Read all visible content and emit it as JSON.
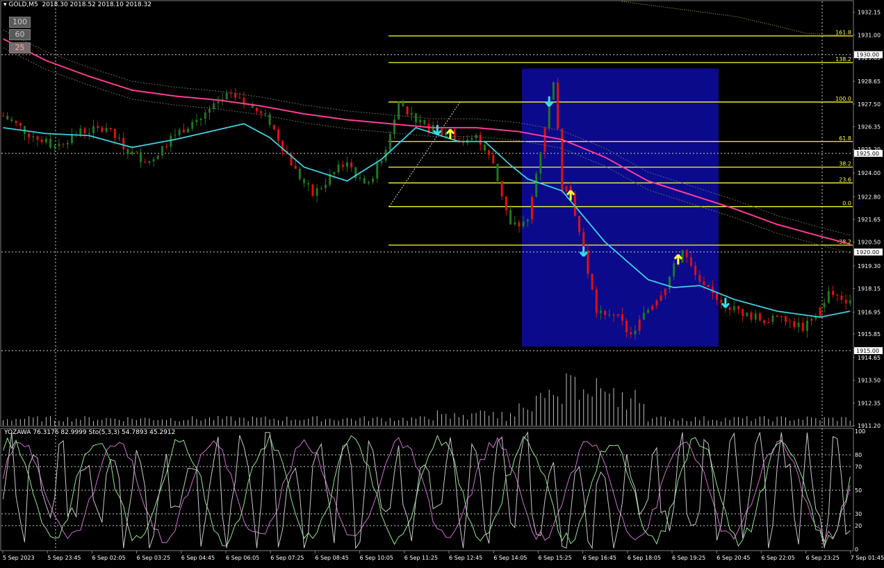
{
  "header": {
    "symbol": "GOLD,M5",
    "ohlc": "2018.30 2018.52 2018.10 2018.32"
  },
  "zoom_buttons": [
    "100",
    "60",
    "25"
  ],
  "colors": {
    "background": "#000000",
    "bull": "#1f7a1f",
    "bear": "#e01010",
    "ma_fast": "#3fd0e0",
    "ma_slow": "#ff3c96",
    "fib": "#ffff33",
    "box": "#0a0a8a",
    "grid": "#cfcfcf",
    "arrow_up": "#ffff33",
    "arrow_down": "#33e0f0"
  },
  "price_axis": {
    "ticks": [
      "1932.15",
      "1931.00",
      "1929.85",
      "1928.65",
      "1927.50",
      "1926.35",
      "1925.20",
      "1924.00",
      "1922.80",
      "1921.65",
      "1920.50",
      "1919.30",
      "1918.15",
      "1916.95",
      "1915.85",
      "1914.65",
      "1913.50",
      "1912.35",
      "1911.20"
    ],
    "highlighted": [
      "1930.00",
      "1925.00",
      "1920.00",
      "1915.00"
    ]
  },
  "fibonacci": {
    "levels": [
      {
        "label": "161.8",
        "price": 1930.95
      },
      {
        "label": "138.2",
        "price": 1929.6
      },
      {
        "label": "100.0",
        "price": 1927.6
      },
      {
        "label": "61.8",
        "price": 1925.6
      },
      {
        "label": "38.2",
        "price": 1924.3
      },
      {
        "label": "23.6",
        "price": 1923.5
      },
      {
        "label": "0.0",
        "price": 1922.3
      },
      {
        "label": "-38.2",
        "price": 1920.35
      }
    ]
  },
  "time_axis": [
    "5 Sep 2023",
    "5 Sep 23:45",
    "6 Sep 02:05",
    "6 Sep 03:25",
    "6 Sep 04:45",
    "6 Sep 06:05",
    "6 Sep 07:25",
    "6 Sep 08:45",
    "6 Sep 10:05",
    "6 Sep 11:25",
    "6 Sep 12:45",
    "6 Sep 14:05",
    "6 Sep 15:25",
    "6 Sep 16:45",
    "6 Sep 18:05",
    "6 Sep 19:25",
    "6 Sep 20:45",
    "6 Sep 22:05",
    "6 Sep 23:25",
    "7 Sep 01:45"
  ],
  "indicator": {
    "label": "YOZAWA 76.3176 82.9999  Sto(5,3,3) 54.7893 45.2912",
    "levels": [
      "100",
      "80",
      "70",
      "50",
      "30",
      "20",
      "0"
    ]
  },
  "chart_data": {
    "type": "candlestick",
    "symbol": "GOLD",
    "timeframe": "M5",
    "y_range": [
      1911.2,
      1932.7
    ],
    "close_path": [
      [
        0,
        1926.9
      ],
      [
        6,
        1926.0
      ],
      [
        12,
        1925.4
      ],
      [
        18,
        1926.1
      ],
      [
        24,
        1926.2
      ],
      [
        30,
        1925.0
      ],
      [
        34,
        1924.6
      ],
      [
        40,
        1926.0
      ],
      [
        46,
        1926.8
      ],
      [
        52,
        1927.9
      ],
      [
        58,
        1927.3
      ],
      [
        62,
        1926.6
      ],
      [
        68,
        1924.1
      ],
      [
        72,
        1922.9
      ],
      [
        76,
        1923.8
      ],
      [
        80,
        1924.6
      ],
      [
        84,
        1923.3
      ],
      [
        88,
        1924.6
      ],
      [
        92,
        1927.6
      ],
      [
        98,
        1926.3
      ],
      [
        104,
        1926.0
      ],
      [
        108,
        1925.5
      ],
      [
        110,
        1925.8
      ],
      [
        114,
        1924.5
      ],
      [
        116,
        1922.9
      ],
      [
        118,
        1921.3
      ],
      [
        122,
        1921.5
      ],
      [
        124,
        1924.0
      ],
      [
        128,
        1928.8
      ],
      [
        130,
        1923.3
      ],
      [
        132,
        1922.9
      ],
      [
        134,
        1921.0
      ],
      [
        138,
        1917.0
      ],
      [
        142,
        1916.9
      ],
      [
        146,
        1915.8
      ],
      [
        150,
        1917.1
      ],
      [
        154,
        1918.3
      ],
      [
        158,
        1920.1
      ],
      [
        162,
        1918.3
      ],
      [
        166,
        1917.7
      ],
      [
        170,
        1917.1
      ],
      [
        176,
        1916.6
      ],
      [
        182,
        1916.5
      ],
      [
        186,
        1916.2
      ],
      [
        188,
        1916.4
      ],
      [
        192,
        1917.9
      ],
      [
        196,
        1917.6
      ]
    ],
    "ma_fast": [
      [
        0,
        1926.3
      ],
      [
        10,
        1926.0
      ],
      [
        20,
        1925.9
      ],
      [
        30,
        1925.3
      ],
      [
        40,
        1925.7
      ],
      [
        50,
        1926.2
      ],
      [
        56,
        1926.5
      ],
      [
        62,
        1925.8
      ],
      [
        70,
        1924.3
      ],
      [
        80,
        1923.6
      ],
      [
        88,
        1924.7
      ],
      [
        96,
        1926.3
      ],
      [
        106,
        1925.6
      ],
      [
        112,
        1925.6
      ],
      [
        118,
        1924.4
      ],
      [
        122,
        1923.7
      ],
      [
        130,
        1923.1
      ],
      [
        140,
        1920.5
      ],
      [
        150,
        1918.6
      ],
      [
        156,
        1918.2
      ],
      [
        162,
        1918.3
      ],
      [
        170,
        1917.6
      ],
      [
        180,
        1917.0
      ],
      [
        190,
        1916.7
      ],
      [
        197,
        1917.0
      ]
    ],
    "ma_slow": [
      [
        0,
        1930.8
      ],
      [
        10,
        1929.7
      ],
      [
        20,
        1928.9
      ],
      [
        30,
        1928.2
      ],
      [
        40,
        1927.9
      ],
      [
        50,
        1927.7
      ],
      [
        60,
        1927.4
      ],
      [
        70,
        1927.0
      ],
      [
        80,
        1926.7
      ],
      [
        90,
        1926.5
      ],
      [
        100,
        1926.3
      ],
      [
        110,
        1926.3
      ],
      [
        120,
        1926.1
      ],
      [
        130,
        1925.7
      ],
      [
        140,
        1924.8
      ],
      [
        150,
        1923.6
      ],
      [
        160,
        1922.9
      ],
      [
        170,
        1922.2
      ],
      [
        180,
        1921.4
      ],
      [
        190,
        1920.8
      ],
      [
        197,
        1920.4
      ]
    ],
    "signals": [
      {
        "type": "down",
        "bar": 101
      },
      {
        "type": "up",
        "bar": 104
      },
      {
        "type": "down",
        "bar": 127
      },
      {
        "type": "up",
        "bar": 132
      },
      {
        "type": "down",
        "bar": 135
      },
      {
        "type": "up",
        "bar": 157
      },
      {
        "type": "down",
        "bar": 168
      }
    ],
    "stochastic": {
      "k": 54.7893,
      "d": 45.2912
    },
    "yozawa": [
      76.3176,
      82.9999
    ]
  }
}
